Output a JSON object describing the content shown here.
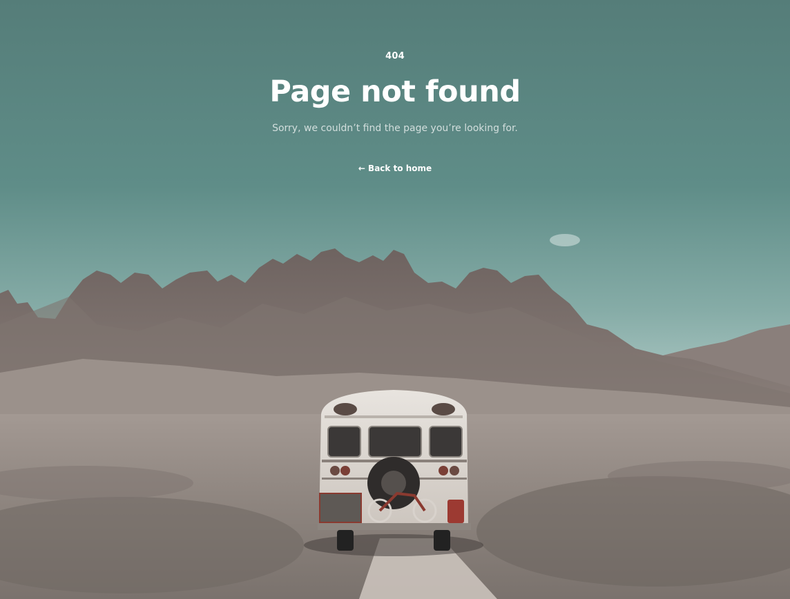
{
  "error": {
    "code": "404",
    "title": "Page not found",
    "message": "Sorry, we couldn’t find the page you’re looking for.",
    "back_link": "← Back to home"
  },
  "colors": {
    "sky_top": "#54807c",
    "sky_bottom": "#9fbfba",
    "mountain": "#7a6e6a",
    "ground": "#948a84",
    "text": "#ffffff"
  }
}
